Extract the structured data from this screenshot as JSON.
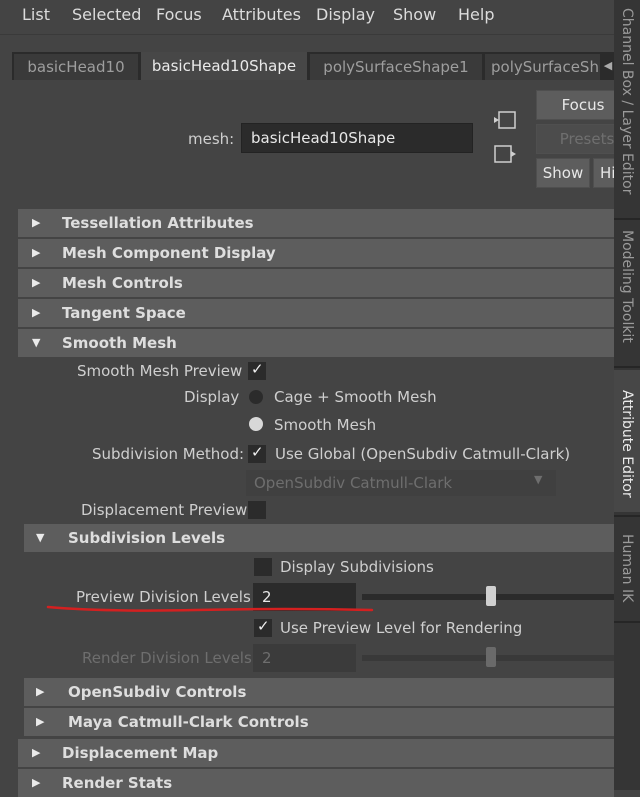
{
  "menu": [
    "List",
    "Selected",
    "Focus",
    "Attributes",
    "Display",
    "Show",
    "Help"
  ],
  "tabs": [
    "basicHead10",
    "basicHead10Shape",
    "polySurfaceShape1",
    "polySurfaceSh"
  ],
  "mesh": {
    "label": "mesh:",
    "value": "basicHead10Shape"
  },
  "buttons": {
    "focus": "Focus",
    "presets": "Presets",
    "show": "Show",
    "hide": "Hi"
  },
  "sections": {
    "tessellation": "Tessellation Attributes",
    "mesh_component_display": "Mesh Component Display",
    "mesh_controls": "Mesh Controls",
    "tangent_space": "Tangent Space",
    "smooth_mesh": "Smooth Mesh",
    "subdivision_levels": "Subdivision Levels",
    "opensubdiv_controls": "OpenSubdiv Controls",
    "maya_catmull_clark": "Maya Catmull-Clark Controls",
    "displacement_map": "Displacement Map",
    "render_stats": "Render Stats"
  },
  "smooth_mesh": {
    "preview_label": "Smooth Mesh Preview",
    "preview_checked": true,
    "display_label": "Display",
    "display_options": [
      "Cage + Smooth Mesh",
      "Smooth Mesh"
    ],
    "display_selected": "Smooth Mesh",
    "subdiv_method_label": "Subdivision Method:",
    "use_global_label": "Use Global (OpenSubdiv Catmull-Clark)",
    "use_global_checked": true,
    "method_dropdown": "OpenSubdiv Catmull-Clark",
    "displacement_preview_label": "Displacement Preview",
    "displacement_preview_checked": false
  },
  "subdivision_levels": {
    "display_subdivisions_label": "Display Subdivisions",
    "display_subdivisions_checked": false,
    "preview_division_label": "Preview Division Levels",
    "preview_division_value": "2",
    "use_preview_for_render_label": "Use Preview Level for Rendering",
    "use_preview_for_render_checked": true,
    "render_division_label": "Render Division Levels",
    "render_division_value": "2"
  },
  "right_tabs": [
    "Channel Box / Layer Editor",
    "Modeling Toolkit",
    "Attribute Editor",
    "Human IK"
  ],
  "colors": {
    "annotation_underline": "#d42020",
    "panel": "#444444",
    "frame_header": "#5d5d5d",
    "field": "#2b2b2b"
  }
}
